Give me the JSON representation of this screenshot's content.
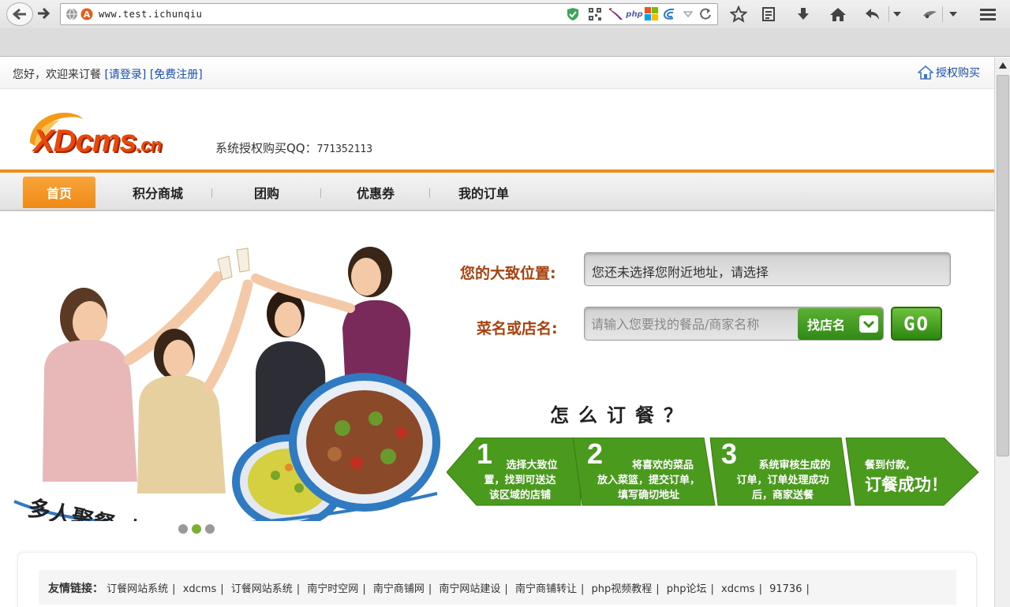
{
  "browser": {
    "url": "www.test.ichunqiu",
    "php_label": "php"
  },
  "topbar": {
    "greeting": "您好，欢迎来订餐",
    "login": "[请登录]",
    "register": "[免费注册]",
    "auth_buy": "授权购买"
  },
  "header": {
    "logo_main": "XDcms",
    "logo_suffix": ".cn",
    "qq_label": "系统授权购买QQ：",
    "qq_number": "771352113"
  },
  "nav": {
    "items": [
      "首页",
      "积分商城",
      "团购",
      "优惠券",
      "我的订单"
    ],
    "active": "首页"
  },
  "banner": {
    "slogan": "多人聚餐 小炒更实惠",
    "dots": 3,
    "active_dot": 2
  },
  "search": {
    "location_label": "您的大致位置:",
    "location_value": "您还未选择您附近地址，请选择",
    "dish_label": "菜名或店名:",
    "dish_placeholder": "请输入您要找的餐品/商家名称",
    "shop_button": "找店名",
    "go_button": "GO"
  },
  "how": {
    "title": "怎么订餐？",
    "steps": [
      {
        "num": "1",
        "lines": [
          "选择大致位",
          "置，找到可送达",
          "该区域的店铺"
        ]
      },
      {
        "num": "2",
        "lines": [
          "将喜欢的菜品",
          "放入菜篮，提交订单，",
          "填写确切地址"
        ]
      },
      {
        "num": "3",
        "lines": [
          "系统审核生成的",
          "订单，订单处理成功",
          "后，商家送餐"
        ]
      },
      {
        "num": "",
        "lines": [
          "餐到付款,"
        ],
        "big": "订餐成功！"
      }
    ],
    "step_color": "#4a9a1e"
  },
  "friend_links": {
    "title": "友情链接：",
    "links": [
      "订餐网站系统",
      "xdcms",
      "订餐网站系统",
      "南宁时空网",
      "南宁商铺网",
      "南宁网站建设",
      "南宁商铺转让",
      "php视频教程",
      "php论坛",
      "xdcms",
      "91736"
    ]
  },
  "colors": {
    "accent": "#f08e1c",
    "label": "#a8420e",
    "link": "#1a4fb0",
    "green": "#3a8f18"
  }
}
